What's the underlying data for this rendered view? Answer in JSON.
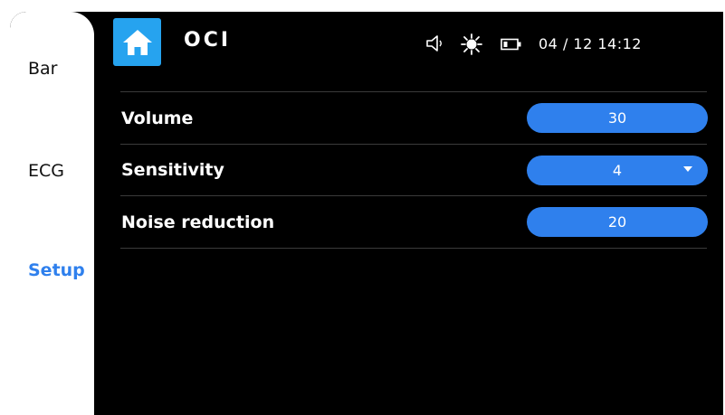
{
  "sidebar": {
    "items": [
      {
        "label": "Bar"
      },
      {
        "label": "ECG"
      },
      {
        "label": "Setup"
      }
    ],
    "active": "Setup"
  },
  "header": {
    "home_icon": "home-icon",
    "title": "OCI",
    "status_icons": [
      "speaker-icon",
      "brightness-icon",
      "battery-icon"
    ],
    "datetime": "04 / 12  14:12"
  },
  "settings": [
    {
      "label": "Volume",
      "value": "30",
      "control": "slider"
    },
    {
      "label": "Sensitivity",
      "value": "4",
      "control": "dropdown"
    },
    {
      "label": "Noise reduction",
      "value": "20",
      "control": "slider"
    }
  ],
  "colors": {
    "background": "#000000",
    "accent": "#2f80ed",
    "home_button": "#26a3ef",
    "sidebar": "#ffffff"
  }
}
